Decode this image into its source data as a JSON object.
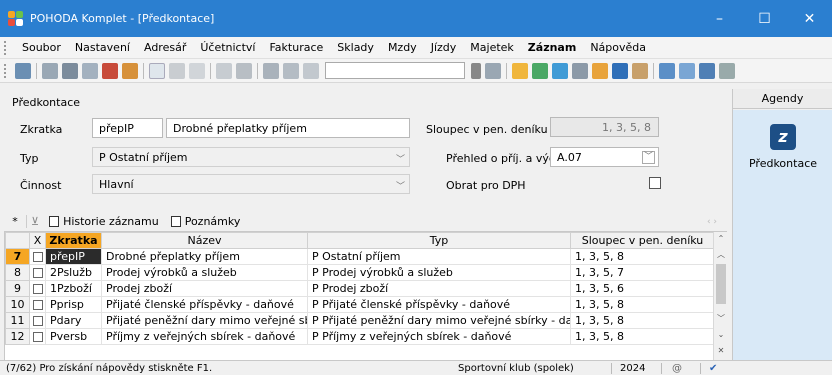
{
  "window": {
    "title": "POHODA Komplet - [Předkontace]",
    "controls": [
      "–",
      "☐",
      "✕"
    ]
  },
  "menu": {
    "items": [
      "Soubor",
      "Nastavení",
      "Adresář",
      "Účetnictví",
      "Fakturace",
      "Sklady",
      "Mzdy",
      "Jízdy",
      "Majetek",
      "Záznam",
      "Nápověda"
    ]
  },
  "form": {
    "group_title": "Předkontace",
    "zkratka_label": "Zkratka",
    "zkratka_value": "přepIP",
    "popis_value": "Drobné přeplatky příjem",
    "typ_label": "Typ",
    "typ_value": "P Ostatní příjem",
    "cinnost_label": "Činnost",
    "cinnost_value": "Hlavní",
    "sloupec_label": "Sloupec v pen. deníku",
    "sloupec_value": "1, 3, 5, 8",
    "prehled_label": "Přehled o příj. a výd.",
    "prehled_value": "A.07",
    "obrat_label": "Obrat pro DPH",
    "obrat_checked": false
  },
  "tabs": {
    "star": "*",
    "historie": "Historie záznamu",
    "poznamky": "Poznámky"
  },
  "table": {
    "headers": [
      "X",
      "Zkratka",
      "Název",
      "Typ",
      "Sloupec v pen. deníku"
    ],
    "rows": [
      {
        "num": "7",
        "code": "přepIP",
        "name": "Drobné přeplatky příjem",
        "type": "P Ostatní příjem",
        "col": "1, 3, 5, 8"
      },
      {
        "num": "8",
        "code": "2Pslužb",
        "name": "Prodej výrobků a služeb",
        "type": "P Prodej výrobků a služeb",
        "col": "1, 3, 5, 7"
      },
      {
        "num": "9",
        "code": "1Pzboží",
        "name": "Prodej zboží",
        "type": "P Prodej zboží",
        "col": "1, 3, 5, 6"
      },
      {
        "num": "10",
        "code": "Pprisp",
        "name": "Přijaté členské příspěvky - daňové",
        "type": "P Přijaté členské příspěvky - daňové",
        "col": "1, 3, 5, 8"
      },
      {
        "num": "11",
        "code": "Pdary",
        "name": "Přijaté peněžní dary mimo veřejné sbírky",
        "type": "P Přijaté peněžní dary mimo veřejné sbírky - daňové",
        "col": "1, 3, 5, 8"
      },
      {
        "num": "12",
        "code": "Pversb",
        "name": "Příjmy z veřejných sbírek - daňové",
        "type": "P Příjmy z veřejných sbírek - daňové",
        "col": "1, 3, 5, 8"
      }
    ]
  },
  "status": {
    "hint": "(7/62) Pro získání nápovědy stiskněte F1.",
    "company": "Sportovní klub (spolek)",
    "year": "2024"
  },
  "agendy": {
    "title": "Agendy",
    "item": "Předkontace"
  },
  "colors": {
    "titlebar": "#2b7fd0",
    "accent": "#f5a623",
    "agenda_bg": "#d9e9f7"
  }
}
